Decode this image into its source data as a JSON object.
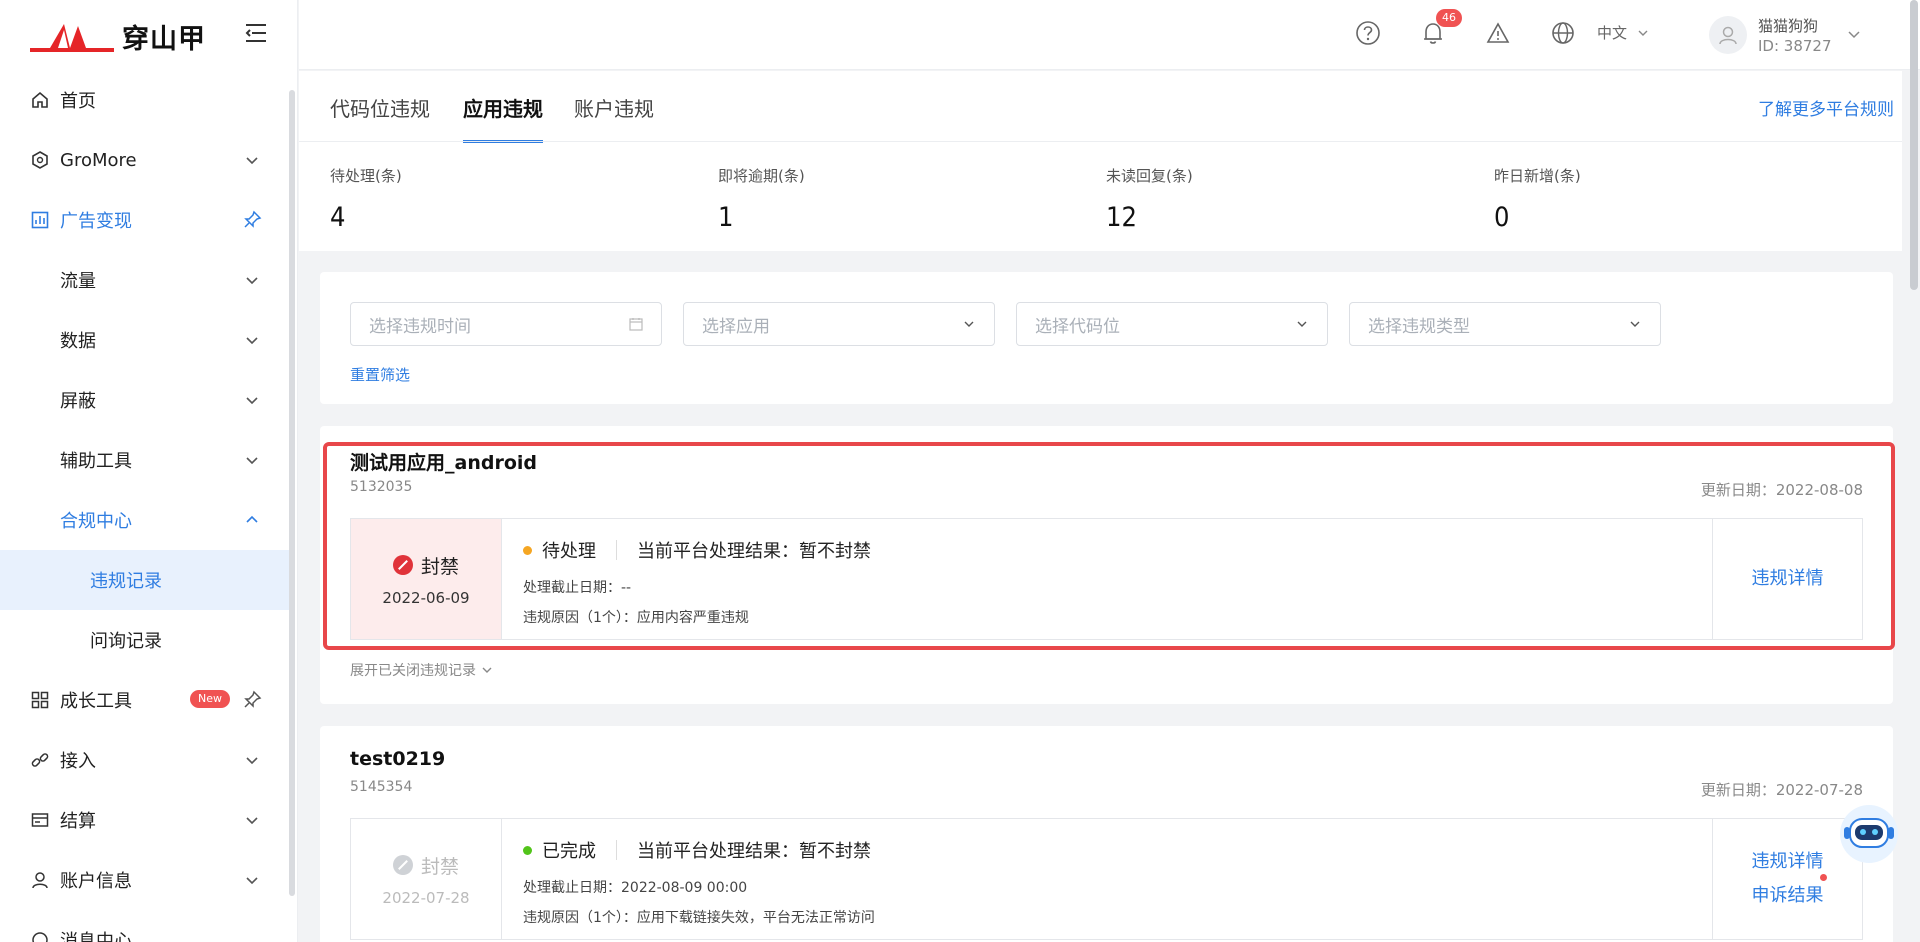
{
  "app": {
    "logo_text": "穿山甲"
  },
  "sidebar": {
    "items": [
      {
        "label": "首页"
      },
      {
        "label": "GroMore"
      },
      {
        "label": "广告变现"
      },
      {
        "label": "流量"
      },
      {
        "label": "数据"
      },
      {
        "label": "屏蔽"
      },
      {
        "label": "辅助工具"
      },
      {
        "label": "合规中心"
      },
      {
        "label": "违规记录"
      },
      {
        "label": "问询记录"
      },
      {
        "label": "成长工具",
        "badge": "New"
      },
      {
        "label": "接入"
      },
      {
        "label": "结算"
      },
      {
        "label": "账户信息"
      },
      {
        "label": "消息中心"
      }
    ]
  },
  "header": {
    "notification_count": "46",
    "language": "中文",
    "user_name": "猫猫狗狗",
    "user_id": "ID: 38727"
  },
  "tabs": [
    {
      "label": "代码位违规"
    },
    {
      "label": "应用违规"
    },
    {
      "label": "账户违规"
    }
  ],
  "more_rules_link": "了解更多平台规则",
  "stats": [
    {
      "label": "待处理(条)",
      "value": "4"
    },
    {
      "label": "即将逾期(条)",
      "value": "1"
    },
    {
      "label": "未读回复(条)",
      "value": "12"
    },
    {
      "label": "昨日新增(条)",
      "value": "0"
    }
  ],
  "filters": {
    "time_placeholder": "选择违规时间",
    "app_placeholder": "选择应用",
    "slot_placeholder": "选择代码位",
    "type_placeholder": "选择违规类型",
    "reset_label": "重置筛选"
  },
  "cards": [
    {
      "app_name": "测试用应用_android",
      "app_id": "5132035",
      "update_date": "更新日期：2022-08-08",
      "status_label": "封禁",
      "status_date": "2022-06-09",
      "state": "待处理",
      "result": "当前平台处理结果：暂不封禁",
      "deadline": "处理截止日期：--",
      "reason": "违规原因（1个）：应用内容严重违规",
      "actions": [
        "违规详情"
      ],
      "expand_label": "展开已关闭违规记录"
    },
    {
      "app_name": "test0219",
      "app_id": "5145354",
      "update_date": "更新日期：2022-07-28",
      "status_label": "封禁",
      "status_date": "2022-07-28",
      "state": "已完成",
      "result": "当前平台处理结果：暂不封禁",
      "deadline": "处理截止日期：2022-08-09 00:00",
      "reason": "违规原因（1个）：应用下载链接失效，平台无法正常访问",
      "actions": [
        "违规详情",
        "申诉结果"
      ]
    }
  ],
  "colors": {
    "accent": "#2f7de1",
    "danger": "#e0333a",
    "pending": "#f5a623",
    "done": "#52c41a"
  }
}
